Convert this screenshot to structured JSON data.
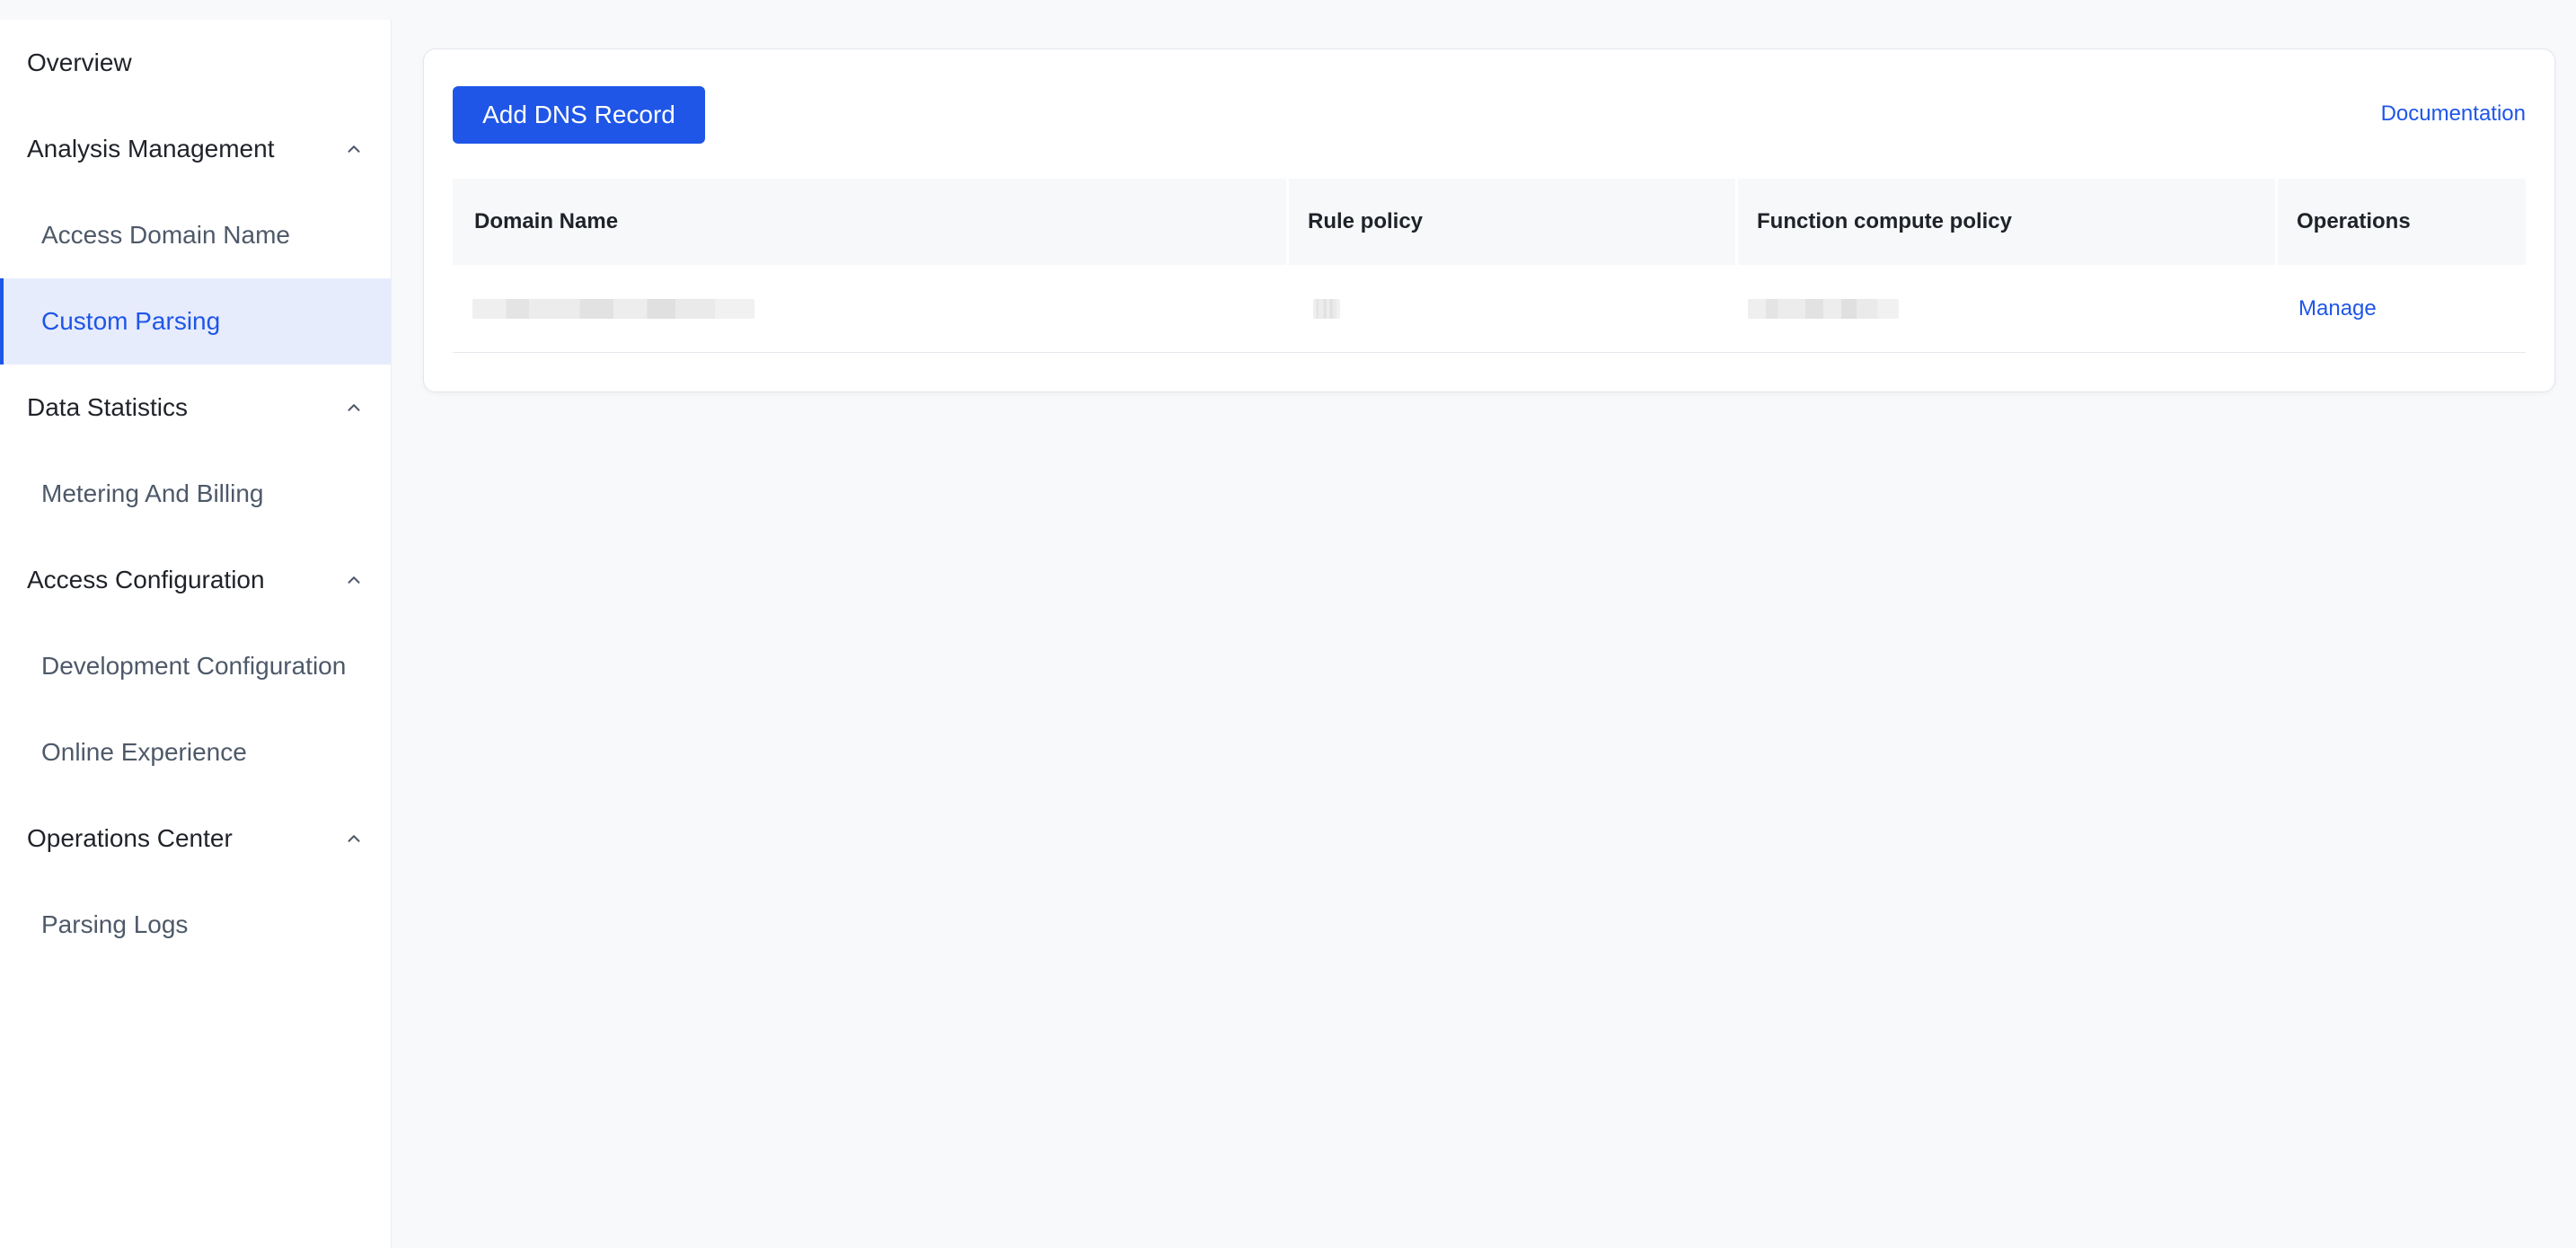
{
  "sidebar": {
    "items": [
      {
        "label": "Overview"
      },
      {
        "label": "Analysis Management"
      },
      {
        "label": "Access Domain Name"
      },
      {
        "label": "Custom Parsing"
      },
      {
        "label": "Data Statistics"
      },
      {
        "label": "Metering And Billing"
      },
      {
        "label": "Access Configuration"
      },
      {
        "label": "Development Configuration"
      },
      {
        "label": "Online Experience"
      },
      {
        "label": "Operations Center"
      },
      {
        "label": "Parsing Logs"
      }
    ],
    "active_item": "Custom Parsing"
  },
  "main": {
    "add_button_label": "Add DNS Record",
    "documentation_link": "Documentation",
    "table": {
      "columns": [
        "Domain Name",
        "Rule policy",
        "Function compute policy",
        "Operations"
      ],
      "rows": [
        {
          "operation": "Manage"
        }
      ]
    }
  },
  "colors": {
    "accent": "#1f56e8",
    "active_bg": "#e7ecfd",
    "page_bg": "#f8f9fb"
  },
  "icons": {
    "group_toggle": "chevron-up-icon"
  }
}
